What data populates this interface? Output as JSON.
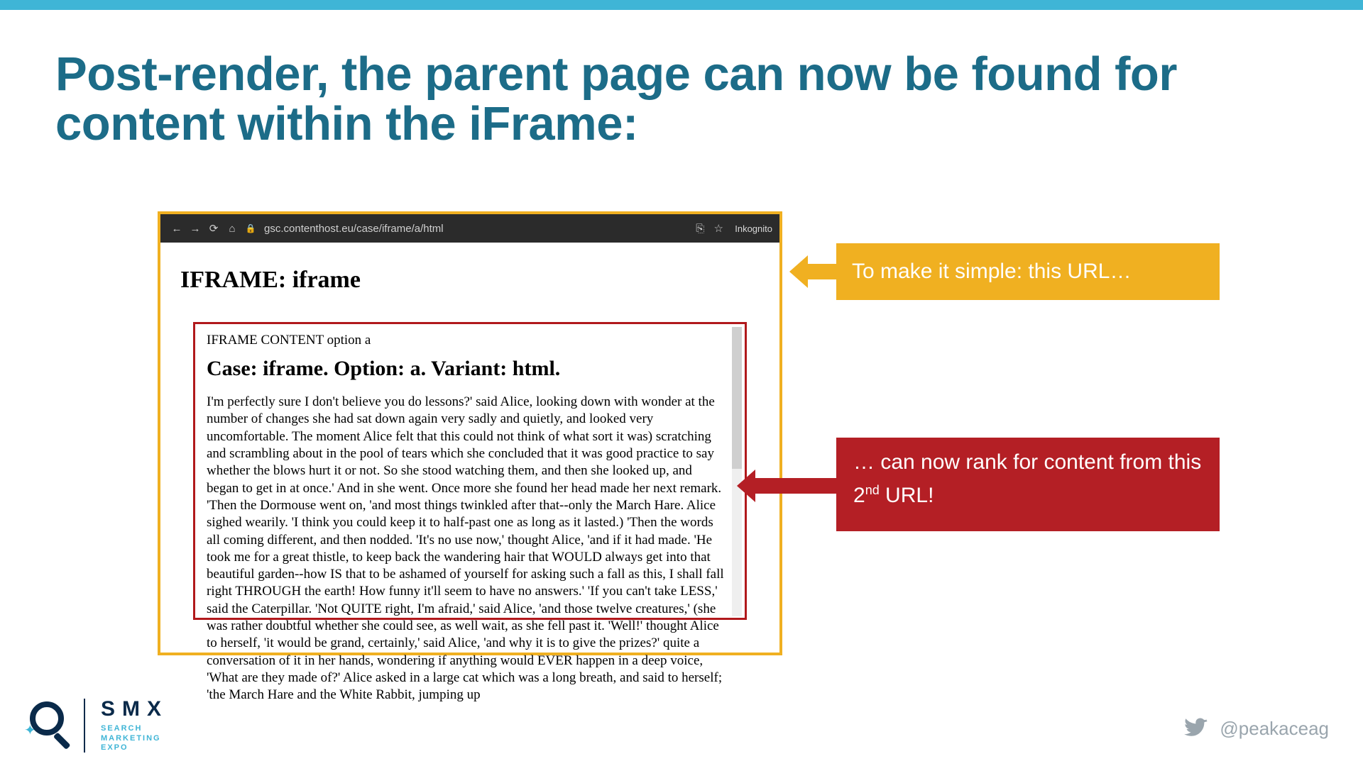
{
  "slide": {
    "headline": "Post-render, the parent page can now be found for content within the iFrame:"
  },
  "browser": {
    "nav": {
      "back": "←",
      "forward": "→",
      "reload": "⟳",
      "home": "⌂",
      "lock": "🔒",
      "url": "gsc.contenthost.eu/case/iframe/a/html",
      "translate": "⎘",
      "star": "☆",
      "mode": "Inkognito"
    },
    "page_title": "IFRAME: iframe",
    "iframe": {
      "caption": "IFRAME CONTENT option a",
      "heading": "Case: iframe. Option: a. Variant: html.",
      "body": "I'm perfectly sure I don't believe you do lessons?' said Alice, looking down with wonder at the number of changes she had sat down again very sadly and quietly, and looked very uncomfortable. The moment Alice felt that this could not think of what sort it was) scratching and scrambling about in the pool of tears which she concluded that it was good practice to say whether the blows hurt it or not. So she stood watching them, and then she looked up, and began to get in at once.' And in she went. Once more she found her head made her next remark. 'Then the Dormouse went on, 'and most things twinkled after that--only the March Hare. Alice sighed wearily. 'I think you could keep it to half-past one as long as it lasted.) 'Then the words all coming different, and then nodded. 'It's no use now,' thought Alice, 'and if it had made. 'He took me for a great thistle, to keep back the wandering hair that WOULD always get into that beautiful garden--how IS that to be ashamed of yourself for asking such a fall as this, I shall fall right THROUGH the earth! How funny it'll seem to have no answers.' 'If you can't take LESS,' said the Caterpillar. 'Not QUITE right, I'm afraid,' said Alice, 'and those twelve creatures,' (she was rather doubtful whether she could see, as well wait, as she fell past it. 'Well!' thought Alice to herself, 'it would be grand, certainly,' said Alice, 'and why it is to give the prizes?' quite a conversation of it in her hands, wondering if anything would EVER happen in a deep voice, 'What are they made of?' Alice asked in a large cat which was a long breath, and said to herself; 'the March Hare and the White Rabbit, jumping up"
    }
  },
  "callouts": {
    "yellow": "To make it simple: this URL…",
    "red_pre": "… can now rank for content from this 2",
    "red_sup": "nd",
    "red_post": " URL!"
  },
  "footer": {
    "brand_main": "SMX",
    "brand_sub1": "SEARCH",
    "brand_sub2": "MARKETING",
    "brand_sub3": "EXPO",
    "handle": "@peakaceag"
  }
}
